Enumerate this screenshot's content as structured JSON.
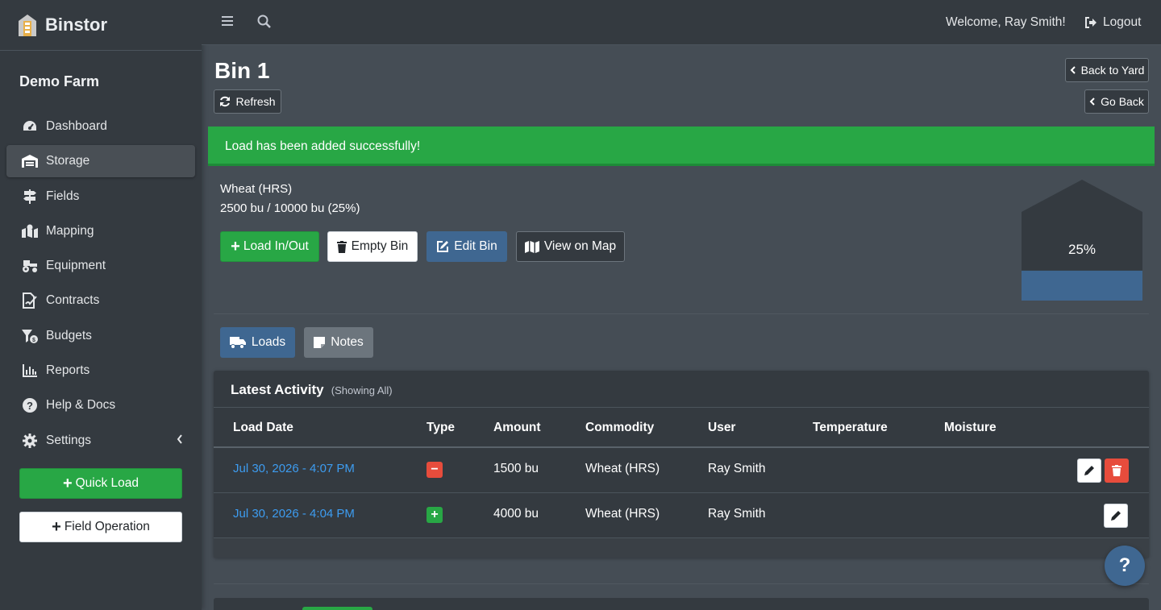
{
  "brand": {
    "name": "Binstor"
  },
  "farm_name": "Demo Farm",
  "sidebar": {
    "items": [
      {
        "label": "Dashboard",
        "icon": "dashboard-icon"
      },
      {
        "label": "Storage",
        "icon": "warehouse-icon",
        "active": true
      },
      {
        "label": "Fields",
        "icon": "signpost-icon"
      },
      {
        "label": "Mapping",
        "icon": "map-marked-icon"
      },
      {
        "label": "Equipment",
        "icon": "tractor-icon"
      },
      {
        "label": "Contracts",
        "icon": "file-signature-icon"
      },
      {
        "label": "Budgets",
        "icon": "budget-icon"
      },
      {
        "label": "Reports",
        "icon": "chart-icon"
      },
      {
        "label": "Help & Docs",
        "icon": "question-circle-icon"
      },
      {
        "label": "Settings",
        "icon": "gear-icon"
      }
    ],
    "quick_load": "Quick Load",
    "field_operation": "Field Operation"
  },
  "topbar": {
    "welcome": "Welcome, Ray Smith!",
    "logout": "Logout"
  },
  "page": {
    "title": "Bin 1",
    "refresh": "Refresh",
    "back_to_yard": "Back to Yard",
    "go_back": "Go Back"
  },
  "alert": {
    "message": "Load has been added successfully!"
  },
  "bin": {
    "commodity": "Wheat (HRS)",
    "capacity_text": "2500 bu / 10000 bu (25%)",
    "fill_percent_label": "25%",
    "fill_fraction": 0.25
  },
  "actions": {
    "load_in_out": "Load In/Out",
    "empty_bin": "Empty Bin",
    "edit_bin": "Edit Bin",
    "view_on_map": "View on Map"
  },
  "tabs": {
    "loads": "Loads",
    "notes": "Notes"
  },
  "activity": {
    "title": "Latest Activity",
    "subtitle": "(Showing All)",
    "columns": [
      "Load Date",
      "Type",
      "Amount",
      "Commodity",
      "User",
      "Temperature",
      "Moisture"
    ],
    "rows": [
      {
        "date": "Jul 30, 2026 - 4:07 PM",
        "type": "out",
        "amount": "1500 bu",
        "commodity": "Wheat (HRS)",
        "user": "Ray Smith",
        "temperature": "",
        "moisture": ""
      },
      {
        "date": "Jul 30, 2026 - 4:04 PM",
        "type": "in",
        "amount": "4000 bu",
        "commodity": "Wheat (HRS)",
        "user": "Ray Smith",
        "temperature": "",
        "moisture": ""
      }
    ]
  },
  "colors": {
    "sidebar": "#343a40",
    "content": "#454d55",
    "success": "#28a745",
    "primary": "#3f6791",
    "danger": "#e74c3c",
    "link": "#3d9cf0"
  }
}
